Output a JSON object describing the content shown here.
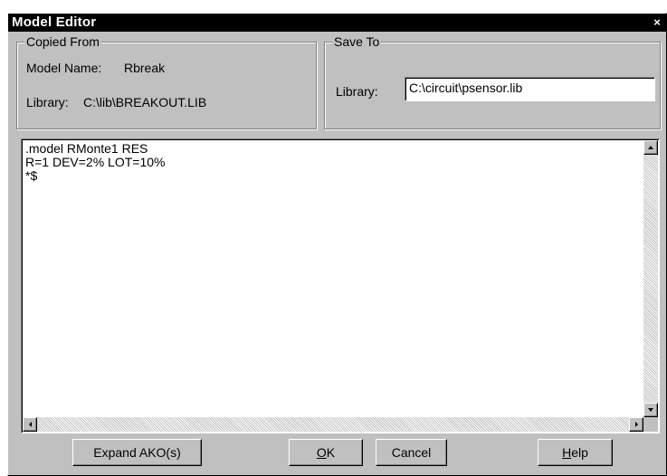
{
  "window": {
    "title": "Model Editor",
    "close_glyph": "×"
  },
  "copied_from": {
    "legend": "Copied From",
    "model_name_label": "Model Name:",
    "model_name_value": "Rbreak",
    "library_label": "Library:",
    "library_value": "C:\\lib\\BREAKOUT.LIB"
  },
  "save_to": {
    "legend": "Save To",
    "library_label": "Library:",
    "library_value": "C:\\circuit\\psensor.lib"
  },
  "editor": {
    "text": ".model RMonte1 RES\nR=1 DEV=2% LOT=10%\n*$"
  },
  "buttons": {
    "expand": "Expand AKO(s)",
    "ok_mnemonic": "O",
    "ok_rest": "K",
    "cancel": "Cancel",
    "help_mnemonic": "H",
    "help_rest": "elp"
  },
  "icons": {
    "close": "close-icon",
    "scroll_up": "arrow-up-icon",
    "scroll_down": "arrow-down-icon",
    "scroll_left": "arrow-left-icon",
    "scroll_right": "arrow-right-icon"
  },
  "colors": {
    "titlebar": "#000000",
    "face": "#c0c0c0",
    "field": "#ffffff"
  }
}
